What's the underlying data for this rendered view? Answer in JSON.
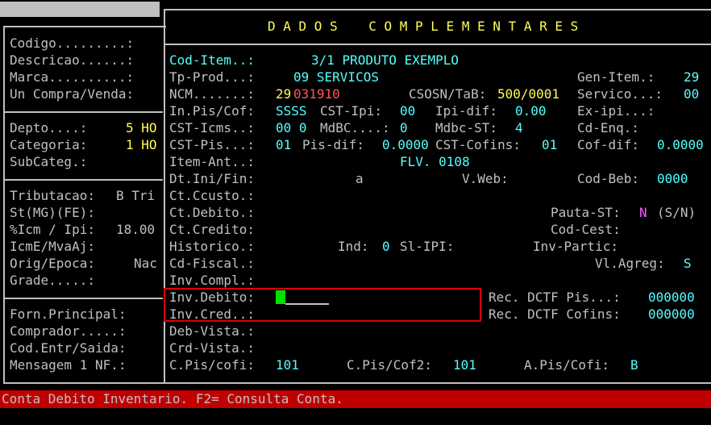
{
  "header": {
    "title": "D A D O S    C O M P L E M E N T A R E S"
  },
  "left": {
    "codigo": "Codigo.........:",
    "descricao": "Descricao......:",
    "marca": "Marca..........:",
    "un_compra": "Un Compra/Venda:",
    "depto_label": "Depto....:",
    "depto_value": "5 HO",
    "categoria_label": "Categoria:",
    "categoria_value": "1 HO",
    "subcateg": "SubCateg.:",
    "tributacao_label": "Tributacao:",
    "tributacao_value": "B Tri",
    "st_label": "St(MG)(FE):",
    "icm_label": "%Icm / Ipi:",
    "icm_value": "18.00",
    "icme_label": "IcmE/MvaAj:",
    "orig_label": "Orig/Epoca:",
    "orig_value": "Nac",
    "grade_label": "Grade.....:",
    "forn": "Forn.Principal:",
    "comprador": "Comprador.....:",
    "cod_entr": "Cod.Entr/Saida:",
    "mensagem": "Mensagem 1 NF.:"
  },
  "main": {
    "cod_item_label": "Cod-Item..:",
    "cod_item_value": "3/1 PRODUTO EXEMPLO",
    "tp_prod_label": "Tp-Prod...:",
    "tp_prod_value": "09 SERVICOS",
    "gen_item_label": "Gen-Item.:",
    "gen_item_value": "29",
    "ncm_label": "NCM.......:",
    "ncm_value_a": "29",
    "ncm_value_b": "031910",
    "csosn_label": "CSOSN/TaB:",
    "csosn_value": "500/0001",
    "servico_label": "Servico...:",
    "servico_value": "00",
    "in_pis_label": "In.Pis/Cof:",
    "in_pis_value": "SSSS",
    "cst_ipi_label": "CST-Ipi:",
    "cst_ipi_value": "00",
    "ipi_dif_label": "Ipi-dif:",
    "ipi_dif_value": "0.00",
    "ex_ipi_label": "Ex-ipi...:",
    "cst_icms_label": "CST-Icms..:",
    "cst_icms_value": "00 0",
    "mdbc_label": "MdBC....:",
    "mdbc_value": "0",
    "mdbc_st_label": "Mdbc-ST:",
    "mdbc_st_value": "4",
    "cd_enq_label": "Cd-Enq.:",
    "cst_pis_label": "CST-Pis...:",
    "cst_pis_value": "01",
    "pis_dif_label": "Pis-dif:",
    "pis_dif_value": "0.0000",
    "cst_cofins_label": "CST-Cofins:",
    "cst_cofins_value": "01",
    "cof_dif_label": "Cof-dif:",
    "cof_dif_value": "0.0000",
    "item_ant_label": "Item-Ant..:",
    "item_ant_value": "FLV. 0108",
    "dt_ini_label": "Dt.Ini/Fin:",
    "dt_ini_sep": "a",
    "v_web_label": "V.Web:",
    "cod_beb_label": "Cod-Beb:",
    "cod_beb_value": "0000",
    "ct_ccusto_label": "Ct.Ccusto.:",
    "ct_debito_label": "Ct.Debito.:",
    "pauta_st_label": "Pauta-ST:",
    "pauta_st_value": "N",
    "pauta_st_hint": "(S/N)",
    "ct_credito_label": "Ct.Credito:",
    "cod_cest_label": "Cod-Cest:",
    "historico_label": "Historico.:",
    "ind_label": "Ind:",
    "ind_value": "0",
    "sl_ipi_label": "Sl-IPI:",
    "inv_partic_label": "Inv-Partic:",
    "cd_fiscal_label": "Cd-Fiscal.:",
    "vl_agreg_label": "Vl.Agreg:",
    "vl_agreg_value": "S",
    "inv_compl_label": "Inv.Compl.:",
    "inv_debito_label": "Inv.Debito:",
    "inv_cred_label": "Inv.Cred..:",
    "rec_dctf_pis_label": "Rec. DCTF Pis...:",
    "rec_dctf_pis_value": "000000",
    "rec_dctf_cofins_label": "Rec. DCTF Cofins:",
    "rec_dctf_cofins_value": "000000",
    "deb_vista_label": "Deb-Vista.:",
    "crd_vista_label": "Crd-Vista.:",
    "c_pis_label": "C.Pis/cofi:",
    "c_pis_value": "101",
    "c_pis2_label": "C.Pis/Cof2:",
    "c_pis2_value": "101",
    "a_pis_label": "A.Pis/Cofi:",
    "a_pis_value": "B"
  },
  "status": {
    "message": "Conta Debito Inventario. F2= Consulta Conta."
  },
  "colors": {
    "label": "#c0c0c0",
    "value": "#55ffff",
    "title": "#ffff55",
    "highlight": "#e00000",
    "status_bg": "#c00000",
    "cursor": "#00e000"
  }
}
